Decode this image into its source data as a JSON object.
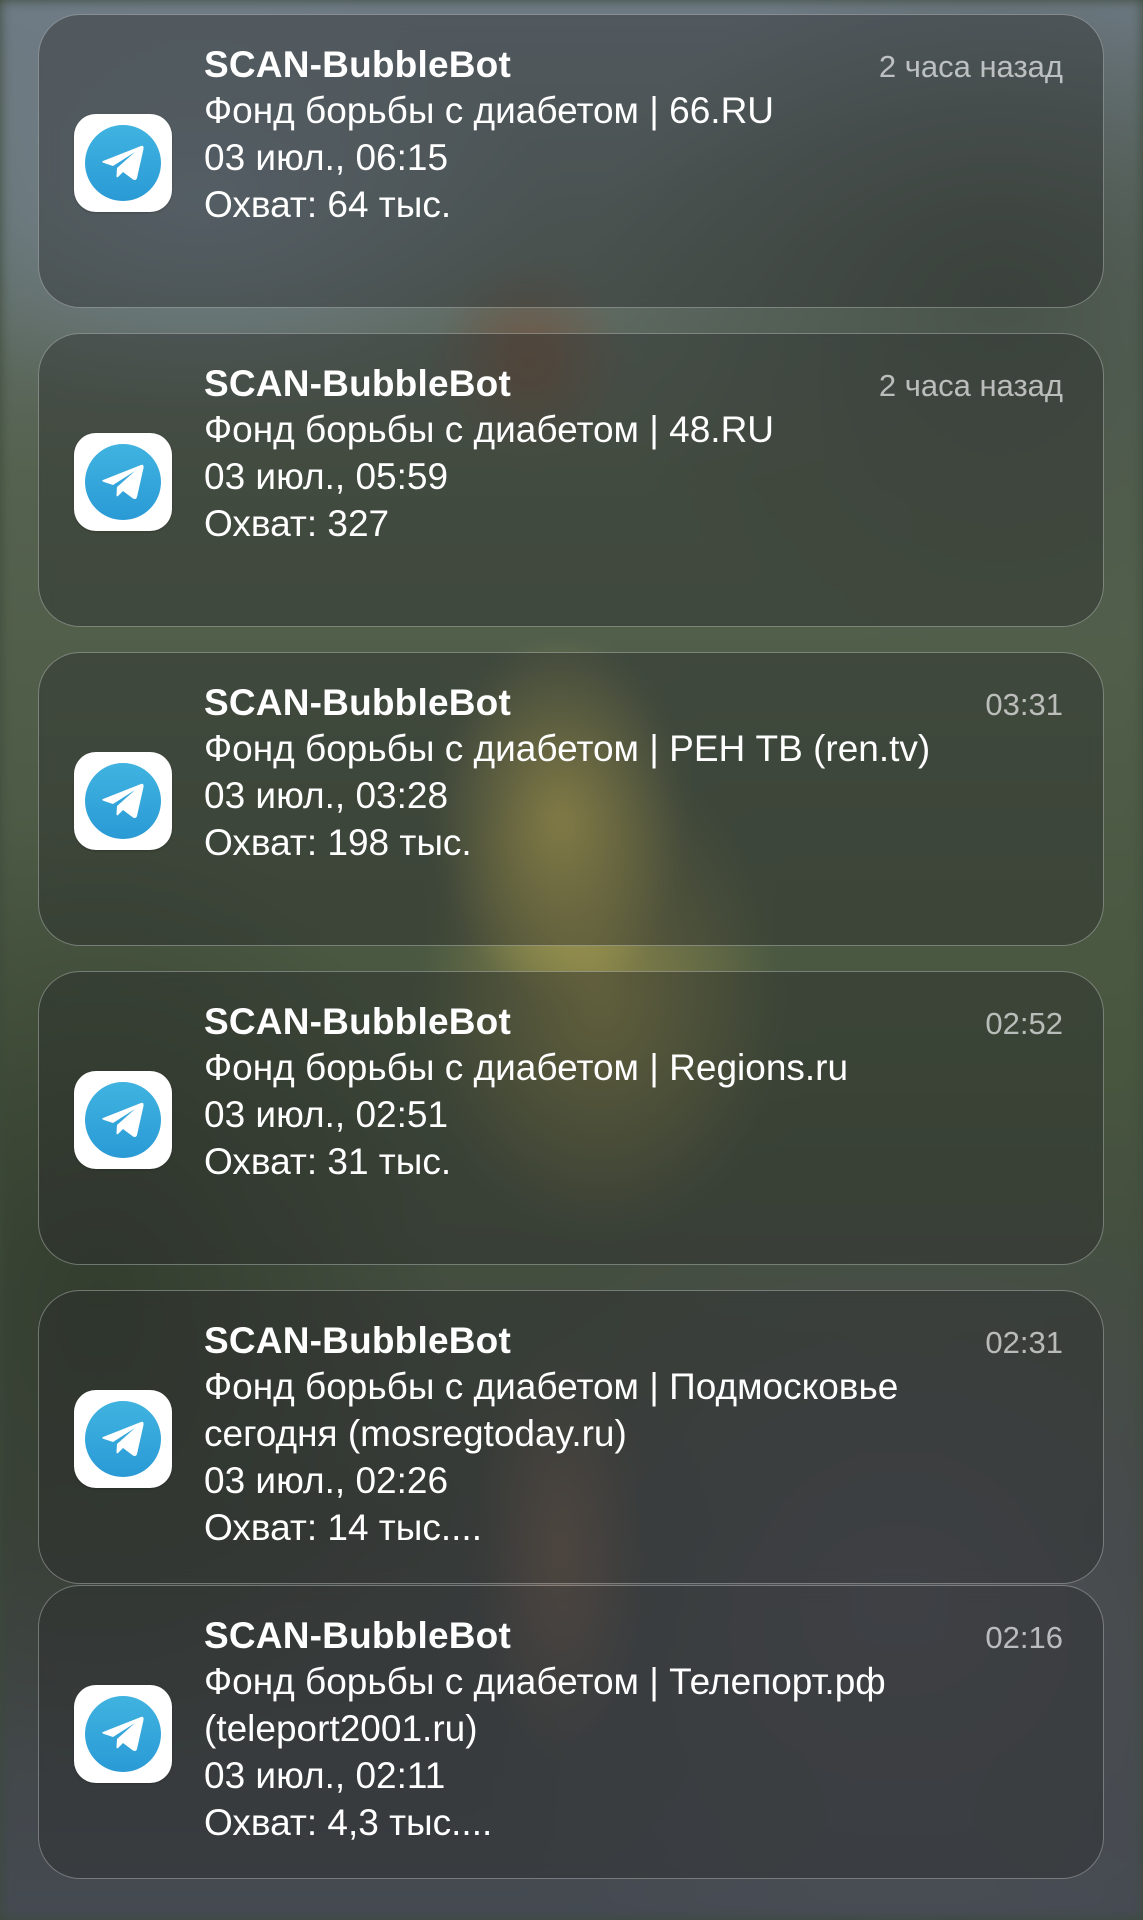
{
  "colors": {
    "telegram_blue": "#2a9ad6",
    "card_background": "rgba(40,42,44,0.42)",
    "time_text": "rgba(235,235,235,0.72)"
  },
  "notifications": [
    {
      "app_icon": "telegram-icon",
      "title": "SCAN-BubbleBot",
      "time": "2 часа назад",
      "lines": [
        "Фонд борьбы с диабетом | 66.RU",
        "03 июл., 06:15",
        "Охват: 64 тыс."
      ]
    },
    {
      "app_icon": "telegram-icon",
      "title": "SCAN-BubbleBot",
      "time": "2 часа назад",
      "lines": [
        "Фонд борьбы с диабетом | 48.RU",
        "03 июл., 05:59",
        "Охват: 327"
      ]
    },
    {
      "app_icon": "telegram-icon",
      "title": "SCAN-BubbleBot",
      "time": "03:31",
      "lines": [
        "Фонд борьбы с диабетом | РЕН ТВ (ren.tv)",
        "03 июл., 03:28",
        "Охват: 198 тыс."
      ]
    },
    {
      "app_icon": "telegram-icon",
      "title": "SCAN-BubbleBot",
      "time": "02:52",
      "lines": [
        "Фонд борьбы с диабетом | Regions.ru",
        "03 июл., 02:51",
        "Охват: 31 тыс."
      ]
    },
    {
      "app_icon": "telegram-icon",
      "title": "SCAN-BubbleBot",
      "time": "02:31",
      "lines": [
        "Фонд борьбы с диабетом | Подмосковье",
        "сегодня (mosregtoday.ru)",
        "03 июл., 02:26",
        "Охват: 14 тыс...."
      ]
    },
    {
      "app_icon": "telegram-icon",
      "title": "SCAN-BubbleBot",
      "time": "02:16",
      "lines": [
        "Фонд борьбы с диабетом | Телепорт.рф",
        "(teleport2001.ru)",
        "03 июл., 02:11",
        "Охват: 4,3 тыс...."
      ]
    }
  ]
}
